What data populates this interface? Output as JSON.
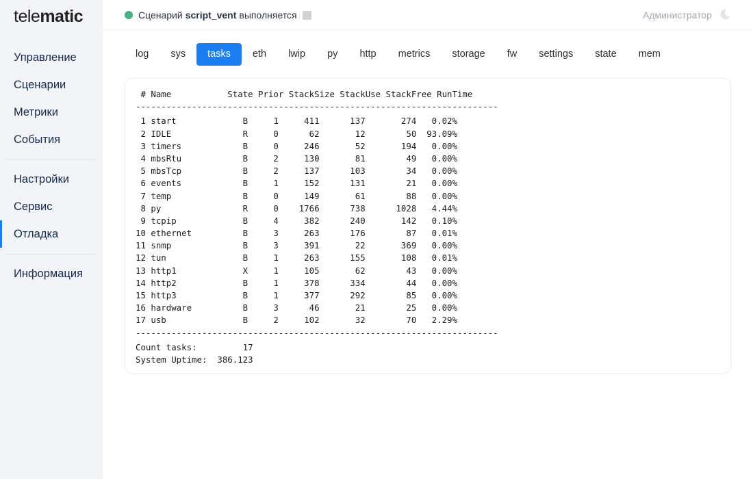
{
  "logo": {
    "part1": "tele",
    "part2": "matic"
  },
  "header": {
    "status_prefix": "Сценарий",
    "script_name": "script_vent",
    "status_suffix": "выполняется",
    "user": "Администратор"
  },
  "sidebar": {
    "items": [
      {
        "label": "Управление"
      },
      {
        "label": "Сценарии"
      },
      {
        "label": "Метрики"
      },
      {
        "label": "События"
      },
      {
        "label": "Настройки"
      },
      {
        "label": "Сервис"
      },
      {
        "label": "Отладка"
      },
      {
        "label": "Информация"
      }
    ]
  },
  "tabs": [
    {
      "label": "log"
    },
    {
      "label": "sys"
    },
    {
      "label": "tasks"
    },
    {
      "label": "eth"
    },
    {
      "label": "lwip"
    },
    {
      "label": "py"
    },
    {
      "label": "http"
    },
    {
      "label": "metrics"
    },
    {
      "label": "storage"
    },
    {
      "label": "fw"
    },
    {
      "label": "settings"
    },
    {
      "label": "state"
    },
    {
      "label": "mem"
    }
  ],
  "console": {
    "headers": [
      "#",
      "Name",
      "State",
      "Prior",
      "StackSize",
      "StackUse",
      "StackFree",
      "RunTime"
    ],
    "rows": [
      [
        "1",
        "start",
        "B",
        "1",
        "411",
        "137",
        "274",
        "0.02%"
      ],
      [
        "2",
        "IDLE",
        "R",
        "0",
        "62",
        "12",
        "50",
        "93.09%"
      ],
      [
        "3",
        "timers",
        "B",
        "0",
        "246",
        "52",
        "194",
        "0.00%"
      ],
      [
        "4",
        "mbsRtu",
        "B",
        "2",
        "130",
        "81",
        "49",
        "0.00%"
      ],
      [
        "5",
        "mbsTcp",
        "B",
        "2",
        "137",
        "103",
        "34",
        "0.00%"
      ],
      [
        "6",
        "events",
        "B",
        "1",
        "152",
        "131",
        "21",
        "0.00%"
      ],
      [
        "7",
        "temp",
        "B",
        "0",
        "149",
        "61",
        "88",
        "0.00%"
      ],
      [
        "8",
        "py",
        "R",
        "0",
        "1766",
        "738",
        "1028",
        "4.44%"
      ],
      [
        "9",
        "tcpip",
        "B",
        "4",
        "382",
        "240",
        "142",
        "0.10%"
      ],
      [
        "10",
        "ethernet",
        "B",
        "3",
        "263",
        "176",
        "87",
        "0.01%"
      ],
      [
        "11",
        "snmp",
        "B",
        "3",
        "391",
        "22",
        "369",
        "0.00%"
      ],
      [
        "12",
        "tun",
        "B",
        "1",
        "263",
        "155",
        "108",
        "0.01%"
      ],
      [
        "13",
        "http1",
        "X",
        "1",
        "105",
        "62",
        "43",
        "0.00%"
      ],
      [
        "14",
        "http2",
        "B",
        "1",
        "378",
        "334",
        "44",
        "0.00%"
      ],
      [
        "15",
        "http3",
        "B",
        "1",
        "377",
        "292",
        "85",
        "0.00%"
      ],
      [
        "16",
        "hardware",
        "B",
        "3",
        "46",
        "21",
        "25",
        "0.00%"
      ],
      [
        "17",
        "usb",
        "B",
        "2",
        "102",
        "32",
        "70",
        "2.29%"
      ]
    ],
    "count_label": "Count tasks:",
    "count_value": "17",
    "uptime_label": "System Uptime:",
    "uptime_value": "386.123"
  },
  "colors": {
    "accent": "#1b7ef2",
    "status_running": "#4caf7f"
  },
  "active_tab": "tasks",
  "active_nav": "Отладка"
}
